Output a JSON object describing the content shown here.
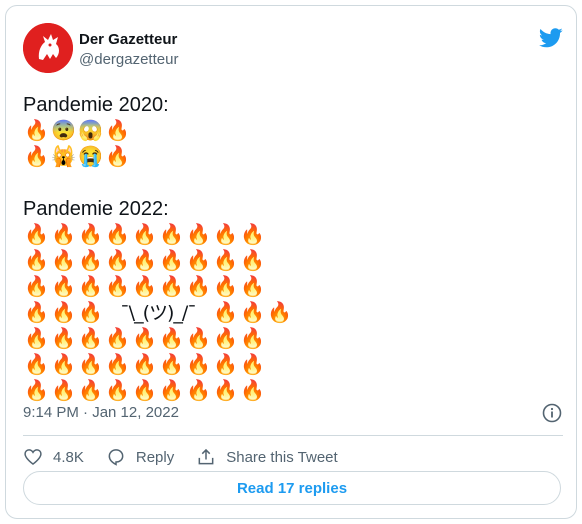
{
  "tweet": {
    "author": {
      "display_name": "Der Gazetteur",
      "handle": "@dergazetteur",
      "avatar_icon": "red-dragon-avatar-icon"
    },
    "platform_icon": "twitter-bird-icon",
    "lines": {
      "heading_2020": "Pandemie 2020:",
      "row_2020_1": [
        "🔥",
        "😨",
        "😱",
        "🔥"
      ],
      "row_2020_2": [
        "🔥",
        "🙀",
        "😭",
        "🔥"
      ],
      "heading_2022": "Pandemie 2022:",
      "grid_2022": [
        [
          "🔥",
          "🔥",
          "🔥",
          "🔥",
          "🔥",
          "🔥",
          "🔥",
          "🔥",
          "🔥"
        ],
        [
          "🔥",
          "🔥",
          "🔥",
          "🔥",
          "🔥",
          "🔥",
          "🔥",
          "🔥",
          "🔥"
        ],
        [
          "🔥",
          "🔥",
          "🔥",
          "🔥",
          "🔥",
          "🔥",
          "🔥",
          "🔥",
          "🔥"
        ],
        [
          "🔥",
          "🔥",
          "🔥",
          "¯\\_(ツ)_/¯",
          "🔥",
          "🔥",
          "🔥"
        ],
        [
          "🔥",
          "🔥",
          "🔥",
          "🔥",
          "🔥",
          "🔥",
          "🔥",
          "🔥",
          "🔥"
        ],
        [
          "🔥",
          "🔥",
          "🔥",
          "🔥",
          "🔥",
          "🔥",
          "🔥",
          "🔥",
          "🔥"
        ],
        [
          "🔥",
          "🔥",
          "🔥",
          "🔥",
          "🔥",
          "🔥",
          "🔥",
          "🔥",
          "🔥"
        ]
      ]
    },
    "timestamp": "9:14 PM · Jan 12, 2022",
    "actions": {
      "like_count": "4.8K",
      "reply_label": "Reply",
      "share_label": "Share this Tweet"
    },
    "read_replies_label": "Read 17 replies"
  },
  "colors": {
    "accent": "#1d9bf0",
    "muted": "#536471",
    "border": "#cfd9de",
    "avatar_bg": "#e0201f"
  }
}
